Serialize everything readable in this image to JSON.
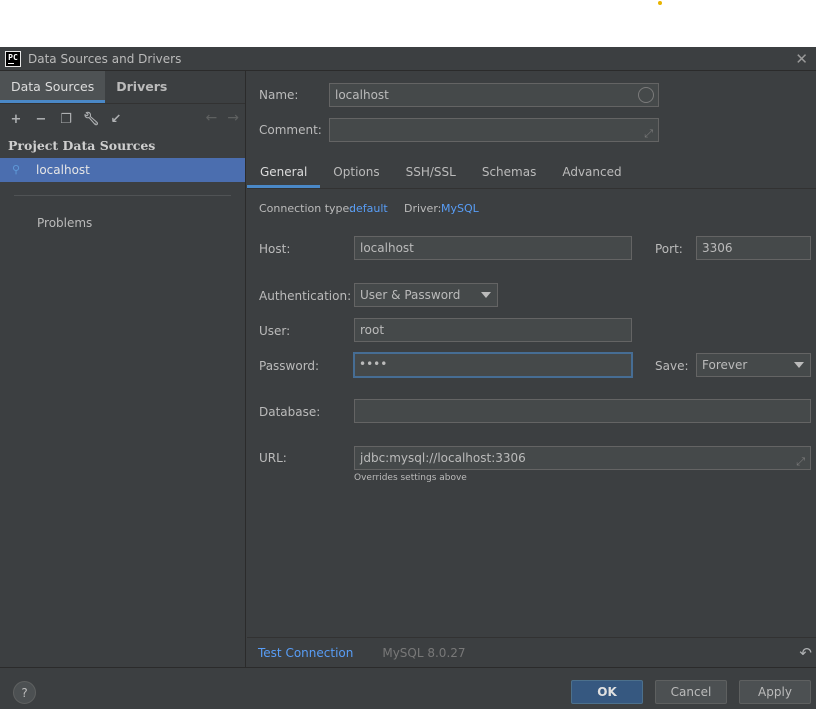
{
  "window": {
    "title": "Data Sources and Drivers",
    "app_icon_label": "PC"
  },
  "left": {
    "tabs": [
      {
        "label": "Data Sources"
      },
      {
        "label": "Drivers"
      }
    ],
    "section_title": "Project Data Sources",
    "selected_item": "localhost",
    "problems_label": "Problems"
  },
  "form": {
    "name_label": "Name:",
    "name_value": "localhost",
    "comment_label": "Comment:",
    "comment_value": "",
    "tabs": [
      {
        "label": "General"
      },
      {
        "label": "Options"
      },
      {
        "label": "SSH/SSL"
      },
      {
        "label": "Schemas"
      },
      {
        "label": "Advanced"
      }
    ],
    "connection_type_label": "Connection type:",
    "connection_type_value": "default",
    "driver_label": "Driver:",
    "driver_value": "MySQL",
    "host_label": "Host:",
    "host_value": "localhost",
    "port_label": "Port:",
    "port_value": "3306",
    "auth_label": "Authentication:",
    "auth_value": "User & Password",
    "user_label": "User:",
    "user_value": "root",
    "password_label": "Password:",
    "password_value": "••••",
    "save_label": "Save:",
    "save_value": "Forever",
    "database_label": "Database:",
    "database_value": "",
    "url_label": "URL:",
    "url_value": "jdbc:mysql://localhost:3306",
    "url_hint": "Overrides settings above"
  },
  "bottom": {
    "test_connection": "Test Connection",
    "server_version": "MySQL 8.0.27"
  },
  "footer": {
    "help": "?",
    "ok": "OK",
    "cancel": "Cancel",
    "apply": "Apply"
  },
  "colors": {
    "background": "#3c3f41",
    "selection": "#4b6eaf",
    "link": "#589df6",
    "primary_button": "#365880"
  }
}
